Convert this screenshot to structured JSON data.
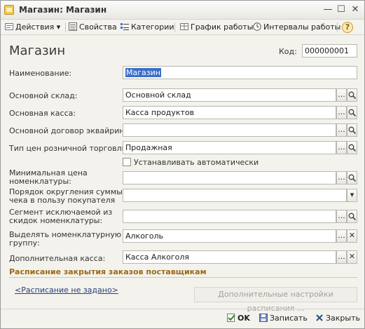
{
  "window": {
    "title": "Магазин: Магазин",
    "controls": [
      "—",
      "☐",
      "✕"
    ]
  },
  "toolbar": {
    "actions_label": "Действия",
    "actions_arrow": "▾",
    "properties_label": "Свойства",
    "categories_label": "Категории",
    "schedule_label": "График работы",
    "intervals_label": "Интервалы работы",
    "help_label": "?"
  },
  "form": {
    "heading": "Магазин",
    "code_label": "Код:",
    "code_value": "000000001",
    "name_label": "Наименование:",
    "name_value": "Магазин",
    "warehouse_label": "Основной склад:",
    "warehouse_value": "Основной склад",
    "cashbox_label": "Основная касса:",
    "cashbox_value": "Касса продуктов",
    "acquiring_label": "Основной договор эквайринга:",
    "acquiring_value": "",
    "price_type_label": "Тип цен розничной торговли:",
    "price_type_value": "Продажная",
    "auto_checkbox_label": "Устанавливать автоматически",
    "min_price_label_1": "Минимальная цена",
    "min_price_label_2": "номенклатуры:",
    "min_price_value": "",
    "rounding_label_1": "Порядок округления суммы",
    "rounding_label_2": "чека в пользу покупателя",
    "rounding_value": "",
    "segment_label_1": "Сегмент исключаемой из",
    "segment_label_2": "скидок номенклатуры:",
    "segment_value": "",
    "group_label_1": "Выделять номенклатурную",
    "group_label_2": "группу:",
    "group_value": "Алкоголь",
    "extra_cashbox_label": "Дополнительная касса:",
    "extra_cashbox_value": "Касса Алкоголя",
    "button_ellipsis": "...",
    "button_dropdown": "▾",
    "button_clear": "✕"
  },
  "schedule": {
    "section_title": "Расписание закрытия заказов поставщикам",
    "link_text": "<Расписание не задано>",
    "settings_button": "Дополнительные настройки расписания ..."
  },
  "footer": {
    "ok_label": "OK",
    "save_label": "Записать",
    "close_label": "Закрыть"
  },
  "colors": {
    "section_title": "#9b6a16",
    "selection": "#3a6fc9",
    "link": "#2a3f7c"
  }
}
